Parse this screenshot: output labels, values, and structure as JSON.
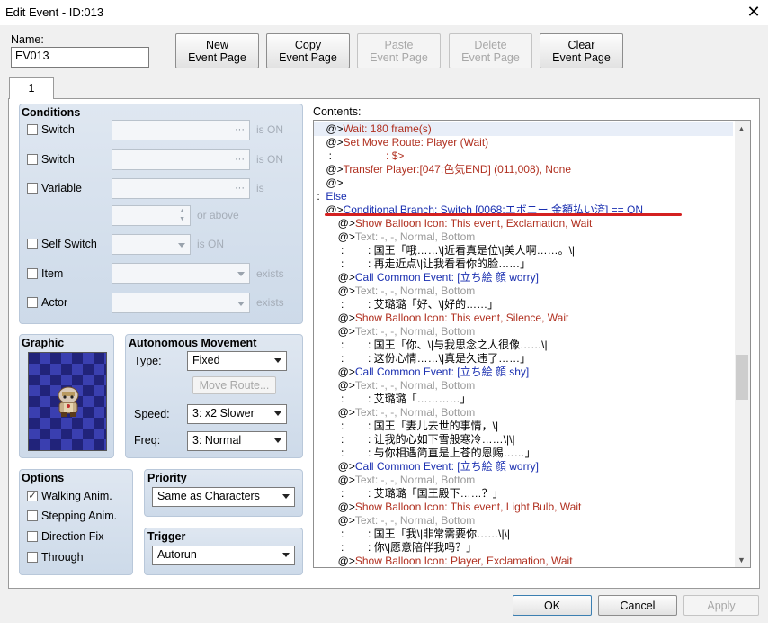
{
  "window": {
    "title": "Edit Event - ID:013"
  },
  "name": {
    "label": "Name:",
    "value": "EV013"
  },
  "toolbar": {
    "new": [
      "New",
      "Event Page"
    ],
    "copy": [
      "Copy",
      "Event Page"
    ],
    "paste": [
      "Paste",
      "Event Page"
    ],
    "delete": [
      "Delete",
      "Event Page"
    ],
    "clear": [
      "Clear",
      "Event Page"
    ]
  },
  "tabs": [
    "1"
  ],
  "conditions": {
    "title": "Conditions",
    "switch1": {
      "label": "Switch",
      "suffix": "is ON"
    },
    "switch2": {
      "label": "Switch",
      "suffix": "is ON"
    },
    "variable": {
      "label": "Variable",
      "suffix": "is",
      "suffix2": "or above"
    },
    "self_switch": {
      "label": "Self Switch",
      "suffix": "is ON"
    },
    "item": {
      "label": "Item",
      "suffix": "exists"
    },
    "actor": {
      "label": "Actor",
      "suffix": "exists"
    }
  },
  "graphic": {
    "title": "Graphic"
  },
  "movement": {
    "title": "Autonomous Movement",
    "type_label": "Type:",
    "type_value": "Fixed",
    "route_button": "Move Route...",
    "speed_label": "Speed:",
    "speed_value": "3: x2 Slower",
    "freq_label": "Freq:",
    "freq_value": "3: Normal"
  },
  "options": {
    "title": "Options",
    "items": [
      {
        "label": "Walking Anim.",
        "checked": true
      },
      {
        "label": "Stepping Anim.",
        "checked": false
      },
      {
        "label": "Direction Fix",
        "checked": false
      },
      {
        "label": "Through",
        "checked": false
      }
    ]
  },
  "priority": {
    "title": "Priority",
    "value": "Same as Characters"
  },
  "trigger": {
    "title": "Trigger",
    "value": "Autorun"
  },
  "contents": {
    "label": "Contents:",
    "lines": [
      {
        "p": "    ",
        "m": "@>",
        "t": "Wait: 180 frame(s)",
        "c": "#b03020"
      },
      {
        "p": "    ",
        "m": "@>",
        "t": "Set Move Route: Player (Wait)",
        "c": "#b03020"
      },
      {
        "p": "    ",
        "m": " :",
        "t": "                  : $>",
        "c": "#b03020"
      },
      {
        "p": "    ",
        "m": "@>",
        "t": "Transfer Player:[047:色気END] (011,008), None",
        "c": "#b03020"
      },
      {
        "p": "    ",
        "m": "@>",
        "t": "",
        "c": "#000000"
      },
      {
        "p": "",
        "m": " :",
        "t": "  Else",
        "c": "#1a2fb0"
      },
      {
        "p": "    ",
        "m": "@>",
        "t": "Conditional Branch: Switch [0068:エボニー 金額払い済] == ON",
        "c": "#1a2fb0"
      },
      {
        "p": "        ",
        "m": "@>",
        "t": "Show Balloon Icon: This event, Exclamation, Wait",
        "c": "#b03020"
      },
      {
        "p": "        ",
        "m": "@>",
        "t": "Text: -, -, Normal, Bottom",
        "c": "#9a9a9a"
      },
      {
        "p": "        ",
        "m": " :",
        "t": "        : 国王「哦……\\|近看真是位\\|美人啊……。\\|",
        "c": "#000000"
      },
      {
        "p": "        ",
        "m": " :",
        "t": "        : 再走近点\\|让我看看你的脸……」",
        "c": "#000000"
      },
      {
        "p": "        ",
        "m": "@>",
        "t": "Call Common Event: [立ち絵 顔 worry]",
        "c": "#1a2fb0"
      },
      {
        "p": "        ",
        "m": "@>",
        "t": "Text: -, -, Normal, Bottom",
        "c": "#9a9a9a"
      },
      {
        "p": "        ",
        "m": " :",
        "t": "        : 艾璐璐「好、\\|好的……」",
        "c": "#000000"
      },
      {
        "p": "        ",
        "m": "@>",
        "t": "Show Balloon Icon: This event, Silence, Wait",
        "c": "#b03020"
      },
      {
        "p": "        ",
        "m": "@>",
        "t": "Text: -, -, Normal, Bottom",
        "c": "#9a9a9a"
      },
      {
        "p": "        ",
        "m": " :",
        "t": "        : 国王「你、\\|与我思念之人很像……\\|",
        "c": "#000000"
      },
      {
        "p": "        ",
        "m": " :",
        "t": "        : 这份心情……\\|真是久违了……」",
        "c": "#000000"
      },
      {
        "p": "        ",
        "m": "@>",
        "t": "Call Common Event: [立ち絵 顔 shy]",
        "c": "#1a2fb0"
      },
      {
        "p": "        ",
        "m": "@>",
        "t": "Text: -, -, Normal, Bottom",
        "c": "#9a9a9a"
      },
      {
        "p": "        ",
        "m": " :",
        "t": "        : 艾璐璐「…………」",
        "c": "#000000"
      },
      {
        "p": "        ",
        "m": "@>",
        "t": "Text: -, -, Normal, Bottom",
        "c": "#9a9a9a"
      },
      {
        "p": "        ",
        "m": " :",
        "t": "        : 国王「妻儿去世的事情，\\|",
        "c": "#000000"
      },
      {
        "p": "        ",
        "m": " :",
        "t": "        : 让我的心如下雪般寒冷……\\|\\|",
        "c": "#000000"
      },
      {
        "p": "        ",
        "m": " :",
        "t": "        : 与你相遇简直是上苍的恩赐……」",
        "c": "#000000"
      },
      {
        "p": "        ",
        "m": "@>",
        "t": "Call Common Event: [立ち絵 顔 worry]",
        "c": "#1a2fb0"
      },
      {
        "p": "        ",
        "m": "@>",
        "t": "Text: -, -, Normal, Bottom",
        "c": "#9a9a9a"
      },
      {
        "p": "        ",
        "m": " :",
        "t": "        : 艾璐璐「国王殿下……？」",
        "c": "#000000"
      },
      {
        "p": "        ",
        "m": "@>",
        "t": "Show Balloon Icon: This event, Light Bulb, Wait",
        "c": "#b03020"
      },
      {
        "p": "        ",
        "m": "@>",
        "t": "Text: -, -, Normal, Bottom",
        "c": "#9a9a9a"
      },
      {
        "p": "        ",
        "m": " :",
        "t": "        : 国王「我\\|非常需要你……\\|\\|",
        "c": "#000000"
      },
      {
        "p": "        ",
        "m": " :",
        "t": "        : 你\\|愿意陪伴我吗？」",
        "c": "#000000"
      },
      {
        "p": "        ",
        "m": "@>",
        "t": "Show Balloon Icon: Player, Exclamation, Wait",
        "c": "#b03020"
      }
    ]
  },
  "footer": {
    "ok": "OK",
    "cancel": "Cancel",
    "apply": "Apply"
  },
  "colors": {
    "annotation_underline": "#d42020",
    "selection": "#e8eef8",
    "command": "#b03020",
    "flow": "#1a2fb0"
  }
}
